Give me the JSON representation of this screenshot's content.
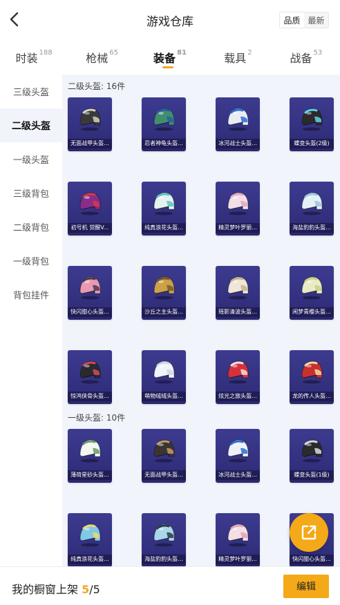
{
  "header": {
    "title": "游戏仓库",
    "sort_options": [
      "品质",
      "最新"
    ],
    "sort_selected": "品质"
  },
  "tabs": [
    {
      "label": "时装",
      "count": "188",
      "active": false
    },
    {
      "label": "枪械",
      "count": "65",
      "active": false
    },
    {
      "label": "装备",
      "count": "81",
      "active": true
    },
    {
      "label": "载具",
      "count": "2",
      "active": false
    },
    {
      "label": "战备",
      "count": "53",
      "active": false
    }
  ],
  "sidebar": {
    "items": [
      {
        "label": "三级头盔",
        "active": false
      },
      {
        "label": "二级头盔",
        "active": true
      },
      {
        "label": "一级头盔",
        "active": false
      },
      {
        "label": "三级背包",
        "active": false
      },
      {
        "label": "二级背包",
        "active": false
      },
      {
        "label": "一级背包",
        "active": false
      },
      {
        "label": "背包挂件",
        "active": false
      }
    ]
  },
  "sections": [
    {
      "title": "二级头盔: 16件",
      "items": [
        {
          "label": "无面战甲头盔...",
          "color": "#3a3a3a",
          "accent": "#d9cfc2"
        },
        {
          "label": "忍者神龟头盔...",
          "color": "#3f8f6f",
          "accent": "#2d5aa8"
        },
        {
          "label": "冰河战士头盔...",
          "color": "#e8ecf3",
          "accent": "#2c6fd6"
        },
        {
          "label": "蝶变头盔(2级)",
          "color": "#2b2b2b",
          "accent": "#5fd3e6"
        },
        {
          "label": "初号机 觉醒V...",
          "color": "#8a2c8c",
          "accent": "#d93b3b"
        },
        {
          "label": "纯真浪花头盔...",
          "color": "#e6f2f0",
          "accent": "#58c7c0"
        },
        {
          "label": "精灵梦叶罗丽...",
          "color": "#f1dfe8",
          "accent": "#e6a6c6"
        },
        {
          "label": "海盐豹豹头盔...",
          "color": "#e4f0f6",
          "accent": "#9ac6de"
        },
        {
          "label": "快闪甜心头盔...",
          "color": "#e99ab0",
          "accent": "#4b3a4a"
        },
        {
          "label": "沙丘之主头盔...",
          "color": "#c9a24a",
          "accent": "#7a5a24"
        },
        {
          "label": "瑶影清波头盔...",
          "color": "#efe6d8",
          "accent": "#c7b38e"
        },
        {
          "label": "闲梦青樱头盔...",
          "color": "#e7ecc6",
          "accent": "#c9cf86"
        },
        {
          "label": "惊鸿侠骨头盔...",
          "color": "#2a2a2e",
          "accent": "#d84a5a"
        },
        {
          "label": "萌物绒绒头盔...",
          "color": "#f1f4f8",
          "accent": "#cdd6e3"
        },
        {
          "label": "炫光之旅头盔...",
          "color": "#d7323c",
          "accent": "#f0e2e2"
        },
        {
          "label": "龙的传人头盔...",
          "color": "#c9302c",
          "accent": "#f2d8a8"
        }
      ]
    },
    {
      "title": "一级头盔: 10件",
      "items": [
        {
          "label": "薄荷星砂头盔...",
          "color": "#f4f6f2",
          "accent": "#6a9a6a"
        },
        {
          "label": "无面战甲头盔...",
          "color": "#3a3531",
          "accent": "#c49a6c"
        },
        {
          "label": "冰河战士头盔...",
          "color": "#eef2f8",
          "accent": "#2c6fd6"
        },
        {
          "label": "蝶变头盔(1级)",
          "color": "#2b2b2b",
          "accent": "#d6dde2"
        },
        {
          "label": "纯真浪花头盔...",
          "color": "#7fc8e6",
          "accent": "#f0d86a"
        },
        {
          "label": "海盐豹豹头盔...",
          "color": "#a9d8ea",
          "accent": "#2d3a44"
        },
        {
          "label": "精灵梦叶罗丽...",
          "color": "#f3dfe4",
          "accent": "#e3a3b6"
        },
        {
          "label": "快闪甜心头盔...",
          "color": "#f2c6cf",
          "accent": "#c98694"
        }
      ]
    }
  ],
  "footer": {
    "text": "我的橱窗上架",
    "current": "5",
    "total": "/5",
    "edit_label": "编辑"
  },
  "colors": {
    "accent": "#f4a918",
    "card_bg": "#3a3888",
    "main_bg": "#f1f4fa"
  }
}
